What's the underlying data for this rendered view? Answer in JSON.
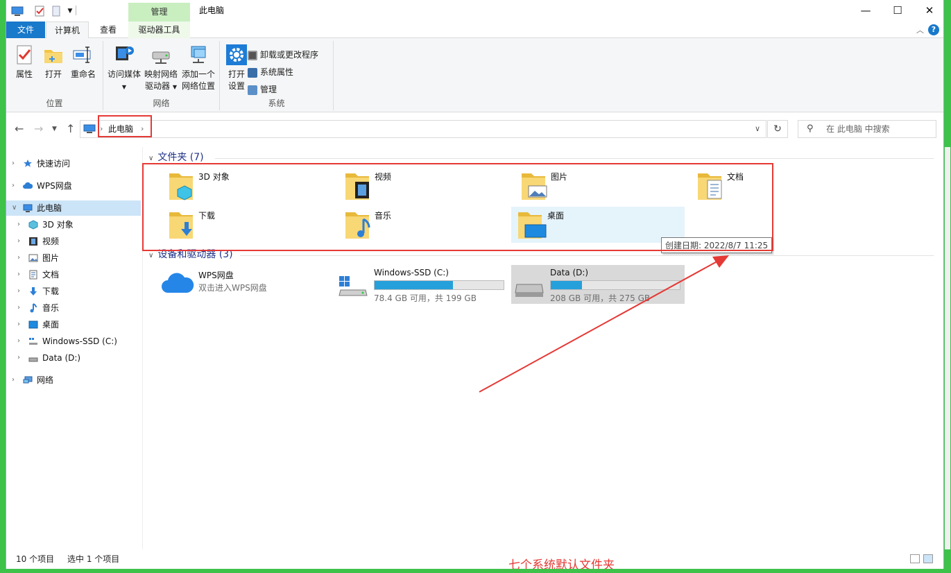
{
  "window": {
    "title": "此电脑",
    "context_tab": "管理"
  },
  "tabs": [
    {
      "label": "文件"
    },
    {
      "label": "计算机"
    },
    {
      "label": "查看"
    },
    {
      "label": "驱动器工具"
    }
  ],
  "ribbon": {
    "location": {
      "label": "位置",
      "buttons": [
        "属性",
        "打开",
        "重命名"
      ]
    },
    "network": {
      "label": "网络",
      "access_media": "访问媒体",
      "map_drive_1": "映射网络",
      "map_drive_2": "驱动器",
      "add_location_1": "添加一个",
      "add_location_2": "网络位置"
    },
    "system": {
      "label": "系统",
      "open_settings_1": "打开",
      "open_settings_2": "设置",
      "uninstall": "卸载或更改程序",
      "system_props": "系统属性",
      "manage": "管理"
    }
  },
  "address": {
    "crumb": "此电脑",
    "search_placeholder": "在 此电脑 中搜索"
  },
  "nav": {
    "quick_access": "快速访问",
    "wps": "WPS网盘",
    "this_pc": "此电脑",
    "children": [
      "3D 对象",
      "视频",
      "图片",
      "文档",
      "下载",
      "音乐",
      "桌面",
      "Windows-SSD (C:)",
      "Data (D:)"
    ],
    "network": "网络"
  },
  "content": {
    "folders_title": "文件夹 (7)",
    "folders": [
      "3D 对象",
      "视频",
      "图片",
      "文档",
      "下载",
      "音乐",
      "桌面"
    ],
    "tooltip": "创建日期: 2022/8/7 11:25",
    "devices_title": "设备和驱动器 (3)",
    "wps": {
      "name": "WPS网盘",
      "subtitle": "双击进入WPS网盘"
    },
    "drives": [
      {
        "name": "Windows-SSD (C:)",
        "info": "78.4 GB 可用，共 199 GB",
        "used_fraction": 0.606
      },
      {
        "name": "Data (D:)",
        "info": "208 GB 可用，共 275 GB",
        "used_fraction": 0.244
      }
    ],
    "annotation": "七个系统默认文件夹"
  },
  "status": {
    "count": "10 个项目",
    "selected": "选中 1 个项目"
  },
  "colors": {
    "accent": "#1979ca",
    "highlight": "#e53935",
    "drive_bar": "#26a0da"
  }
}
